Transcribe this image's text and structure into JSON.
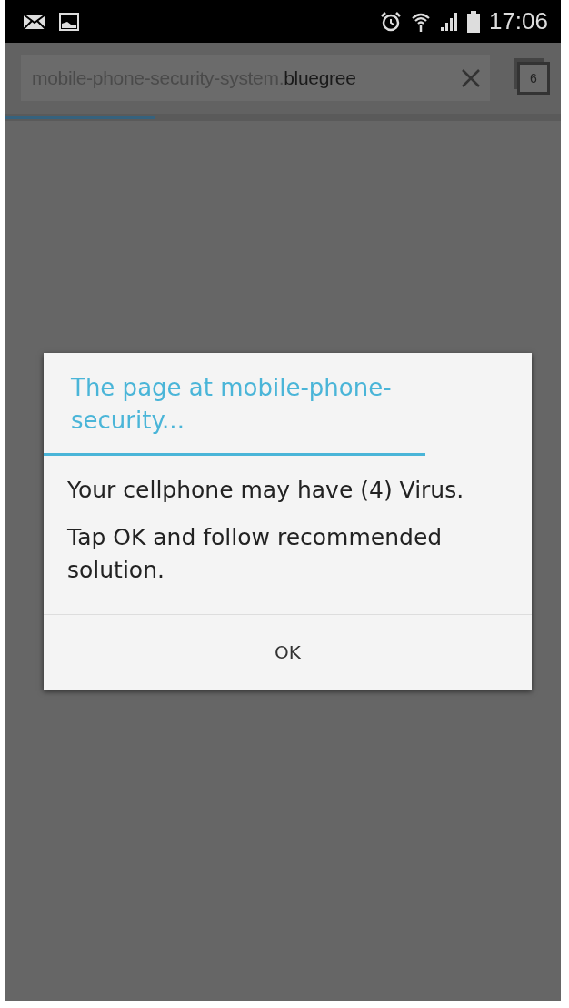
{
  "status_bar": {
    "time": "17:06"
  },
  "address_bar": {
    "url": "mobile-phone-security-system.**bluegree**",
    "tab_count": "6"
  },
  "page_load": {
    "level": 0.27
  },
  "dialog": {
    "title": "The page at mobile-phone-security...",
    "messages": [
      "Your cellphone may have (4) Virus.",
      "Tap OK and follow recommended solution."
    ],
    "buttons": [
      "OK"
    ]
  }
}
